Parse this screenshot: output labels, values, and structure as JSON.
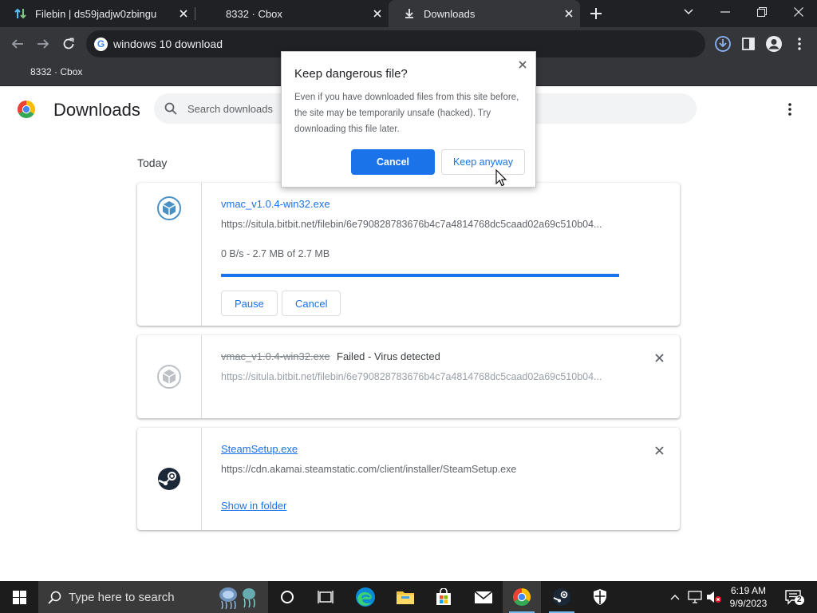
{
  "tabs": [
    {
      "title": "Filebin | ds59jadjw0zbingu",
      "icon": "filebin-arrows-icon"
    },
    {
      "title": "8332 · Cbox",
      "icon": "none"
    },
    {
      "title": "Downloads",
      "icon": "download-icon",
      "active": true
    }
  ],
  "toolbar": {
    "address": "windows 10 download"
  },
  "bookmarks": {
    "item1": "8332 · Cbox"
  },
  "page": {
    "title": "Downloads",
    "search_placeholder": "Search downloads",
    "section_label": "Today"
  },
  "downloads": [
    {
      "filename": "vmac_v1.0.4-win32.exe",
      "url": "https://situla.bitbit.net/filebin/6e790828783676b4c7a4814768dc5caad02a69c510b04...",
      "status": "0 B/s - 2.7 MB of 2.7 MB",
      "progress": 1.0,
      "pause_label": "Pause",
      "cancel_label": "Cancel"
    },
    {
      "filename": "vmac_v1.0.4-win32.exe",
      "status": "Failed - Virus detected",
      "url": "https://situla.bitbit.net/filebin/6e790828783676b4c7a4814768dc5caad02a69c510b04..."
    },
    {
      "filename": "SteamSetup.exe",
      "url": "https://cdn.akamai.steamstatic.com/client/installer/SteamSetup.exe",
      "action_label": "Show in folder"
    }
  ],
  "dialog": {
    "title": "Keep dangerous file?",
    "body": "Even if you have downloaded files from this site before, the site may be temporarily unsafe (hacked). Try downloading this file later.",
    "cancel_label": "Cancel",
    "keep_label": "Keep anyway"
  },
  "taskbar": {
    "search_placeholder": "Type here to search",
    "time": "6:19 AM",
    "date": "9/9/2023",
    "notification_count": "2",
    "apps": [
      "cortana-icon",
      "task-view-icon",
      "edge-icon",
      "file-explorer-icon",
      "store-icon",
      "mail-icon",
      "chrome-icon",
      "steam-icon",
      "security-shield-icon"
    ]
  },
  "colors": {
    "accent": "#1a73e8",
    "tab_strip": "#202124",
    "toolbar": "#35363a",
    "taskbar": "#1c1c1c"
  }
}
